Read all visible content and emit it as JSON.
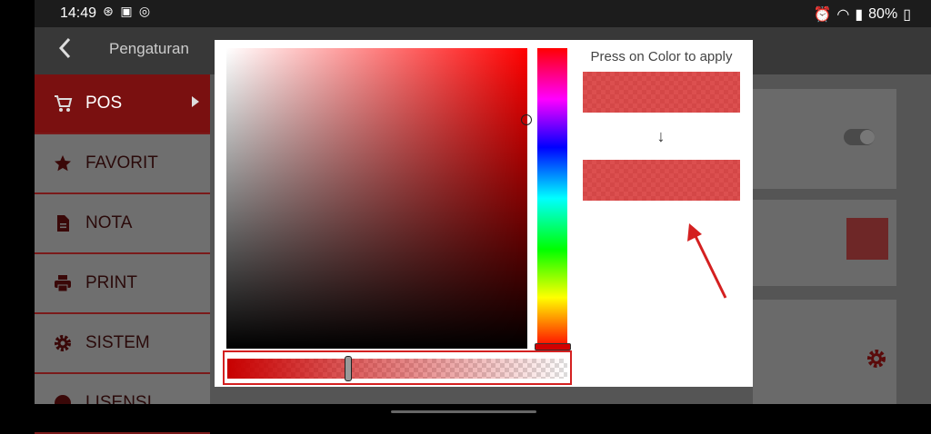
{
  "status": {
    "time": "14:49",
    "battery": "80%"
  },
  "appbar": {
    "title": "Pengaturan"
  },
  "sidebar": {
    "items": [
      {
        "label": "POS",
        "icon": "cart-icon",
        "active": true
      },
      {
        "label": "FAVORIT",
        "icon": "star-icon"
      },
      {
        "label": "NOTA",
        "icon": "document-icon"
      },
      {
        "label": "PRINT",
        "icon": "printer-icon"
      },
      {
        "label": "SISTEM",
        "icon": "gear-icon"
      },
      {
        "label": "LISENSI",
        "icon": "globe-icon"
      }
    ]
  },
  "color_picker": {
    "apply_label": "Press on Color to apply",
    "arrow": "↓",
    "accent_color": "#d42020",
    "selected_color": "#d73737"
  },
  "colors": {
    "active_item": "#7a1010",
    "swatch": "#6e2727"
  }
}
